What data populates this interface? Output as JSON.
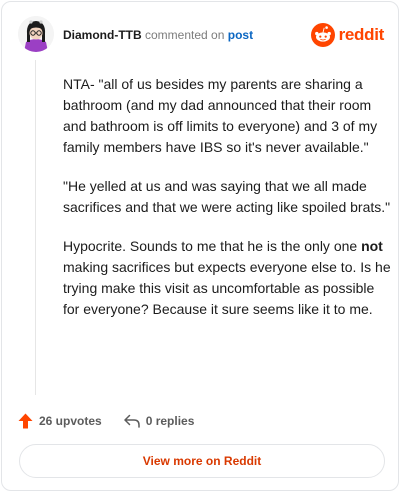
{
  "header": {
    "username": "Diamond-TTB",
    "verb": "commented on",
    "target": "post",
    "brand": "reddit",
    "avatar_icon": "avatar-girl-with-glasses",
    "brand_icon": "reddit-alien-icon"
  },
  "comment": {
    "paragraphs": [
      "NTA- \"all of us besides my parents are sharing a bathroom (and my dad announced that their room and bathroom is off limits to everyone) and 3 of my family members have IBS so it's never available.\"",
      "\"He yelled at us and was saying that we all made sacrifices and that we were acting like spoiled brats.\""
    ],
    "last_paragraph": {
      "before": "Hypocrite. Sounds to me that he is the only one ",
      "bold": "not",
      "after": " making sacrifices but expects everyone else to. Is he trying make this visit as uncomfortable as possible for everyone? Because it sure seems like it to me."
    }
  },
  "actions": {
    "upvotes": "26 upvotes",
    "replies": "0 replies",
    "upvote_icon": "upvote-arrow-icon",
    "reply_icon": "reply-arrow-icon"
  },
  "footer": {
    "button": "View more on Reddit"
  },
  "colors": {
    "accent": "#ff4500",
    "link": "#0a66c2",
    "button_text": "#d93900"
  }
}
